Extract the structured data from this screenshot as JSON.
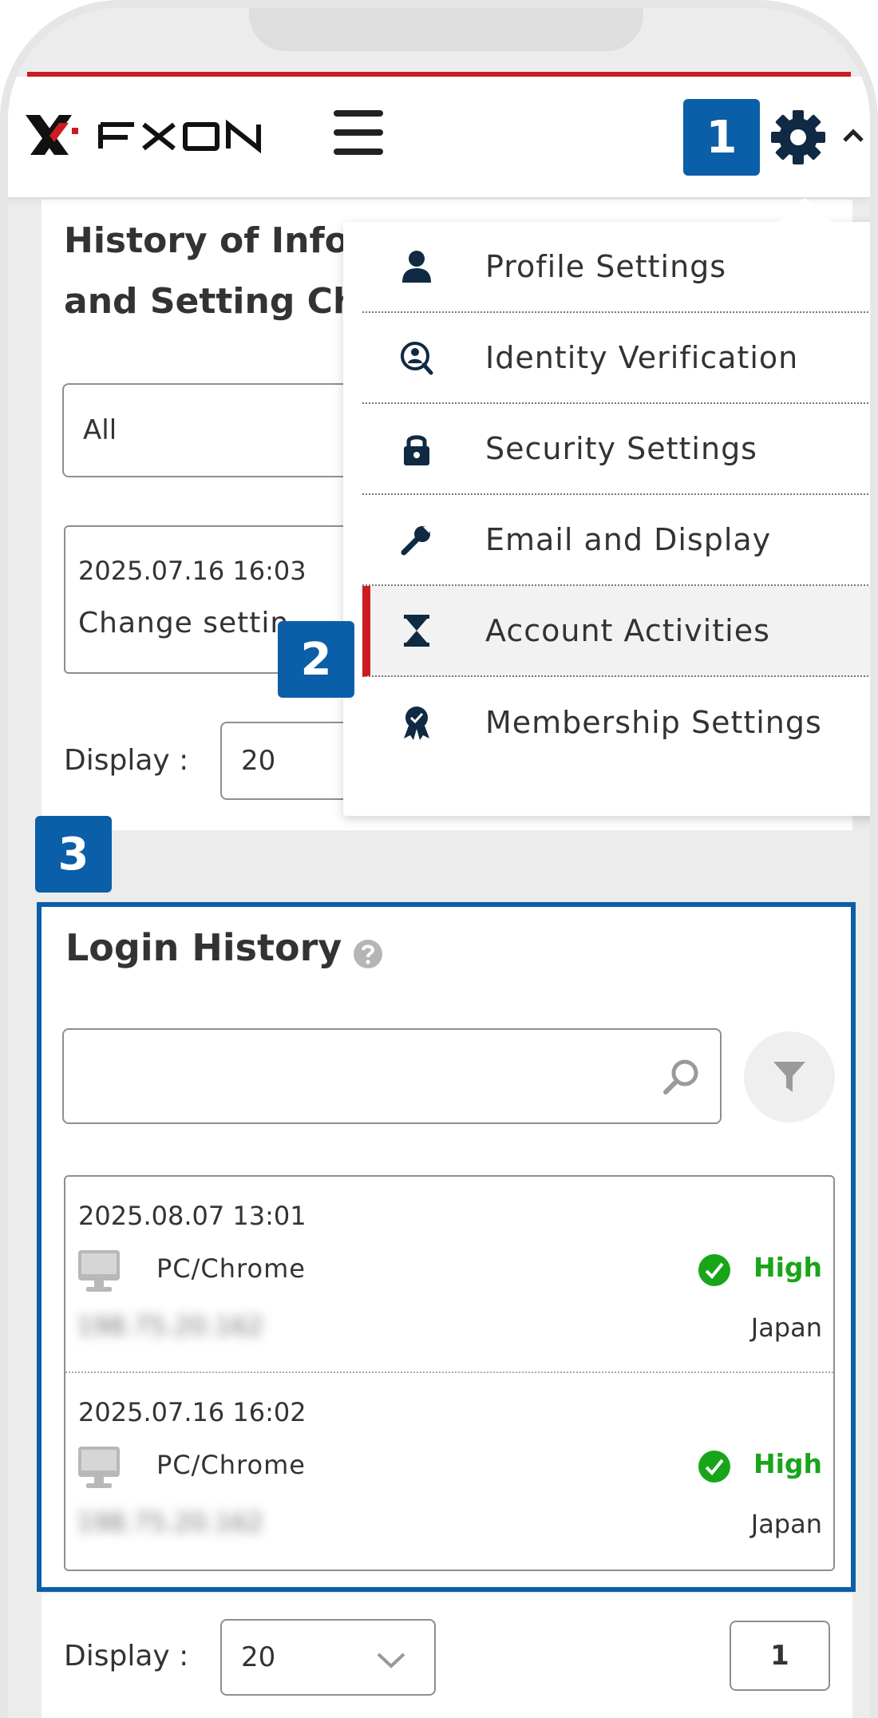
{
  "header": {
    "brand": "FXON",
    "badge_1": "1",
    "badge_2": "2",
    "badge_3": "3"
  },
  "background_section": {
    "title_line1": "History of Info",
    "title_line2": "and Setting Ch",
    "filter_value": "All",
    "entry_date": "2025.07.16 16:03",
    "entry_text": "Change settin",
    "display_label": "Display :",
    "display_value": "20"
  },
  "menu": {
    "items": [
      {
        "label": "Profile Settings",
        "icon": "person-icon"
      },
      {
        "label": "Identity Verification",
        "icon": "id-search-icon"
      },
      {
        "label": "Security Settings",
        "icon": "lock-icon"
      },
      {
        "label": "Email and Display",
        "icon": "wrench-icon"
      },
      {
        "label": "Account Activities",
        "icon": "hourglass-icon",
        "active": true
      },
      {
        "label": "Membership Settings",
        "icon": "ribbon-badge-icon"
      }
    ]
  },
  "login_history": {
    "title": "Login History",
    "search_placeholder": "",
    "rows": [
      {
        "date": "2025.08.07 13:01",
        "device": "PC/Chrome",
        "level": "High",
        "ip": "198.75.20.162",
        "country": "Japan"
      },
      {
        "date": "2025.07.16 16:02",
        "device": "PC/Chrome",
        "level": "High",
        "ip": "198.75.20.162",
        "country": "Japan"
      }
    ],
    "display_label": "Display :",
    "display_value": "20",
    "page": "1"
  },
  "colors": {
    "accent_blue": "#0b5ea8",
    "brand_red": "#cc1b23",
    "success_green": "#19a519"
  }
}
